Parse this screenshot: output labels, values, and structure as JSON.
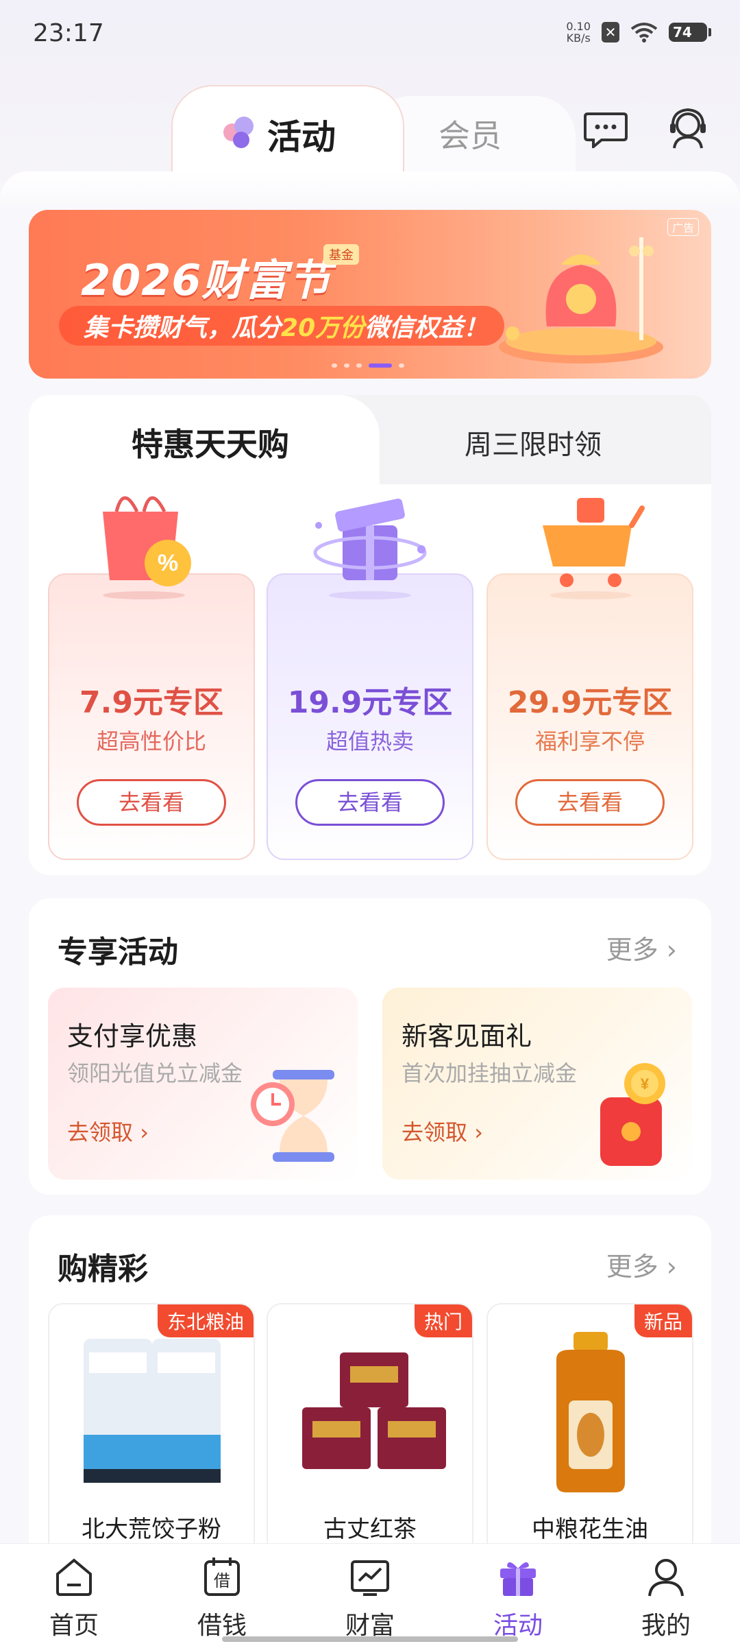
{
  "status": {
    "time": "23:17",
    "net_speed_value": "0.10",
    "net_speed_unit": "KB/s",
    "battery": "74"
  },
  "header": {
    "tabs": [
      {
        "label": "活动",
        "active": true
      },
      {
        "label": "会员",
        "active": false
      }
    ],
    "icons": [
      "message-icon",
      "customer-service-icon"
    ]
  },
  "banner": {
    "title": "2026财富节",
    "tag": "基金",
    "ad_label": "广告",
    "subtitle_prefix": "集卡攒财气，瓜分",
    "subtitle_highlight": "20万份",
    "subtitle_suffix": "微信权益！",
    "page_count": 5,
    "active_page": 4
  },
  "daily": {
    "tabs": [
      {
        "label": "特惠天天购",
        "active": true
      },
      {
        "label": "周三限时领",
        "active": false
      }
    ],
    "zones": [
      {
        "title": "7.9元专区",
        "subtitle": "超高性价比",
        "button": "去看看",
        "color": "#e05145"
      },
      {
        "title": "19.9元专区",
        "subtitle": "超值热卖",
        "button": "去看看",
        "color": "#7a4fd6"
      },
      {
        "title": "29.9元专区",
        "subtitle": "福利享不停",
        "button": "去看看",
        "color": "#e2693a"
      }
    ]
  },
  "exclusive": {
    "title": "专享活动",
    "more": "更多",
    "items": [
      {
        "title": "支付享优惠",
        "subtitle": "领阳光值兑立减金",
        "link": "去领取"
      },
      {
        "title": "新客见面礼",
        "subtitle": "首次加挂抽立减金",
        "link": "去领取"
      }
    ]
  },
  "shopping": {
    "title": "购精彩",
    "more": "更多",
    "products": [
      {
        "name": "北大荒饺子粉",
        "badge": "东北粮油"
      },
      {
        "name": "古丈红茶",
        "badge": "热门"
      },
      {
        "name": "中粮花生油",
        "badge": "新品"
      }
    ]
  },
  "bottom_nav": [
    {
      "label": "首页",
      "icon": "home-icon",
      "active": false
    },
    {
      "label": "借钱",
      "icon": "borrow-icon",
      "active": false
    },
    {
      "label": "财富",
      "icon": "wealth-icon",
      "active": false
    },
    {
      "label": "活动",
      "icon": "gift-icon",
      "active": true
    },
    {
      "label": "我的",
      "icon": "profile-icon",
      "active": false
    }
  ],
  "colors": {
    "accent_purple": "#7b4de2",
    "banner_orange": "#ff7a55",
    "badge_red": "#f24b2f"
  }
}
